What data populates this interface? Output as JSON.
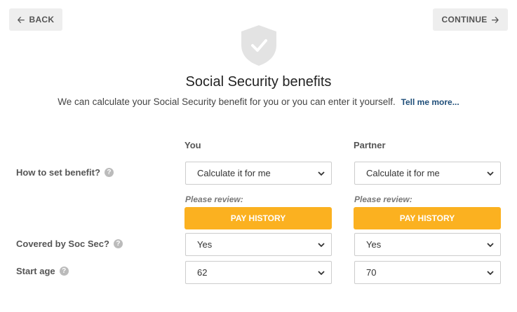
{
  "nav": {
    "back_label": "BACK",
    "continue_label": "CONTINUE"
  },
  "header": {
    "title": "Social Security benefits",
    "subtitle": "We can calculate your Social Security benefit for you or you can enter it yourself.",
    "tell_more": "Tell me more..."
  },
  "columns": {
    "you": "You",
    "partner": "Partner"
  },
  "rows": {
    "benefit_label": "How to set benefit?",
    "covered_label": "Covered by Soc Sec?",
    "start_label": "Start age"
  },
  "you": {
    "benefit_value": "Calculate it for me",
    "review_label": "Please review:",
    "pay_history": "PAY HISTORY",
    "covered_value": "Yes",
    "start_age": "62"
  },
  "partner": {
    "benefit_value": "Calculate it for me",
    "review_label": "Please review:",
    "pay_history": "PAY HISTORY",
    "covered_value": "Yes",
    "start_age": "70"
  },
  "colors": {
    "accent": "#fbb120",
    "link": "#1f4e79",
    "shield": "#e3e3e3"
  },
  "icons": {
    "help": "question-circle-icon",
    "shield": "shield-check-icon",
    "back": "arrow-left-icon",
    "continue": "arrow-right-icon",
    "select": "chevron-down-icon"
  }
}
